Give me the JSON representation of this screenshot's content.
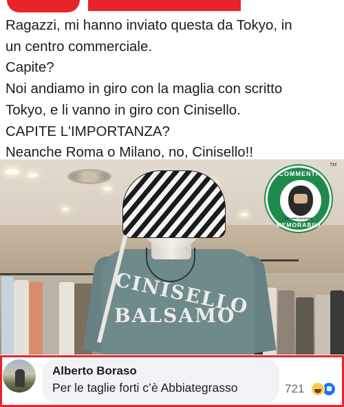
{
  "post": {
    "lines": [
      "Ragazzi, mi hanno inviato questa da Tokyo, in",
      "un centro commerciale.",
      "Capite?",
      "Noi andiamo in giro con la maglia con scritto",
      "Tokyo, e li vanno in giro con Cinisello.",
      "CAPITE L'IMPORTANZA?",
      "Neanche Roma o Milano, no, Cinisello!!"
    ]
  },
  "photo": {
    "shirt_print_line1": "CINISELLO",
    "shirt_print_line2": "BALSAMO"
  },
  "badge": {
    "top_text": "COMMENTI",
    "middle_text": "NATI PER IGNORARE",
    "bottom_text": "MEMORABILI",
    "trademark": "TM",
    "color": "#1f8a4c"
  },
  "comment": {
    "author": "Alberto Boraso",
    "text": "Per le taglie forti c’è Abbiategrasso",
    "reaction_count": "721",
    "reactions": [
      "haha-icon",
      "like-icon"
    ],
    "highlight_color": "#e8232a"
  }
}
